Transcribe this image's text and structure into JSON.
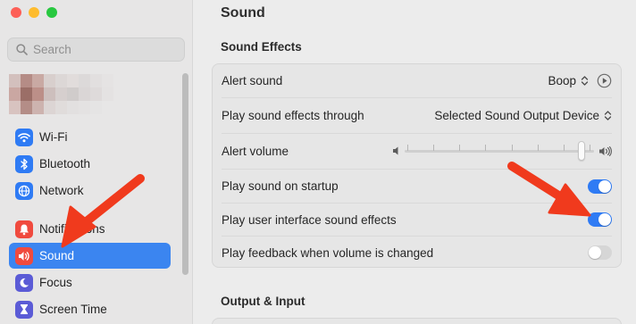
{
  "window": {
    "title": "Sound"
  },
  "sidebar": {
    "search": {
      "placeholder": "Search"
    },
    "items": [
      {
        "label": "Wi-Fi",
        "icon": "wifi-icon",
        "color": "#2f7bf4"
      },
      {
        "label": "Bluetooth",
        "icon": "bluetooth-icon",
        "color": "#2f7bf4"
      },
      {
        "label": "Network",
        "icon": "globe-icon",
        "color": "#2f7bf4"
      },
      {
        "label": "Notifications",
        "icon": "bell-icon",
        "color": "#f04a3e"
      },
      {
        "label": "Sound",
        "icon": "speaker-icon",
        "color": "#f04a3e",
        "selected": true
      },
      {
        "label": "Focus",
        "icon": "moon-icon",
        "color": "#5b5bd6"
      },
      {
        "label": "Screen Time",
        "icon": "hourglass-icon",
        "color": "#5b5bd6"
      }
    ],
    "selected_color": "#3b85f0"
  },
  "main": {
    "title": "Sound",
    "sound_effects": {
      "heading": "Sound Effects",
      "rows": {
        "alert_sound": {
          "label": "Alert sound",
          "value": "Boop"
        },
        "play_through": {
          "label": "Play sound effects through",
          "value": "Selected Sound Output Device"
        },
        "alert_volume": {
          "label": "Alert volume",
          "level": 0.95
        },
        "startup": {
          "label": "Play sound on startup",
          "on": true
        },
        "ui_effects": {
          "label": "Play user interface sound effects",
          "on": true
        },
        "feedback": {
          "label": "Play feedback when volume is changed",
          "on": false
        }
      }
    },
    "output_input": {
      "heading": "Output & Input"
    }
  },
  "colors": {
    "toggle_on": "#2f7bf4",
    "annotation_arrow": "#f03a1d"
  }
}
